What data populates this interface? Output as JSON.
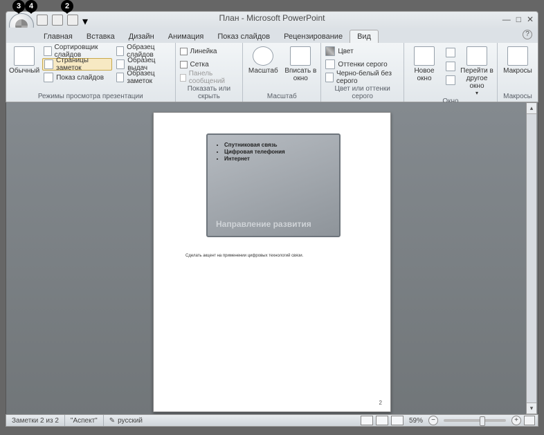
{
  "callouts": {
    "c3": "3",
    "c4": "4",
    "c2": "2"
  },
  "title": "План - Microsoft PowerPoint",
  "tabs": {
    "home": "Главная",
    "insert": "Вставка",
    "design": "Дизайн",
    "animation": "Анимация",
    "slideshow": "Показ слайдов",
    "review": "Рецензирование",
    "view": "Вид"
  },
  "ribbon": {
    "normal": "Обычный",
    "sorter": "Сортировщик слайдов",
    "notes_page": "Страницы заметок",
    "slideshow": "Показ слайдов",
    "master_slide": "Образец слайдов",
    "master_handout": "Образец выдач",
    "master_notes": "Образец заметок",
    "group_views": "Режимы просмотра презентации",
    "ruler": "Линейка",
    "grid": "Сетка",
    "msgbar": "Панель сообщений",
    "group_show": "Показать или скрыть",
    "zoom": "Масштаб",
    "fit": "Вписать в окно",
    "group_zoom": "Масштаб",
    "color": "Цвет",
    "gray": "Оттенки серого",
    "bw": "Черно-белый без серого",
    "group_color": "Цвет или оттенки серого",
    "newwin": "Новое окно",
    "switch": "Перейти в другое окно",
    "group_window": "Окно",
    "macros": "Макросы",
    "group_macros": "Макросы"
  },
  "slide": {
    "b1": "Спутниковая связь",
    "b2": "Цифровая телефония",
    "b3": "Интернет",
    "title": "Направление развития",
    "notes": "Сделать акцент на применении цифровых технологий связи.",
    "pagenum": "2"
  },
  "status": {
    "pageinfo": "Заметки 2 из 2",
    "theme": "\"Аспект\"",
    "lang": "русский",
    "zoom": "59%"
  }
}
